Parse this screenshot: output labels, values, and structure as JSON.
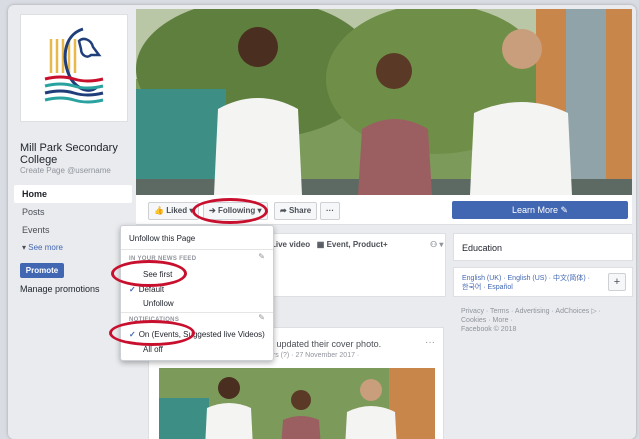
{
  "page": {
    "name": "Mill Park Secondary College",
    "handle": "Create Page @username"
  },
  "nav": {
    "items": [
      "Home",
      "Posts",
      "Events"
    ],
    "see_more": "See more",
    "promote": "Promote",
    "manage": "Manage promotions"
  },
  "actions": {
    "liked": "Liked",
    "following": "Following",
    "share": "Share",
    "more": "···",
    "learn_more": "Learn More"
  },
  "menu": {
    "unfollow_page": "Unfollow this Page",
    "news_feed_head": "IN YOUR NEWS FEED",
    "see_first": "See first",
    "default": "Default",
    "unfollow": "Unfollow",
    "notifications_head": "NOTIFICATIONS",
    "on_events": "On (Events, Suggested live Videos)",
    "all_off": "All off"
  },
  "composer": {
    "tab_live": "Live video",
    "tab_event": "Event, Product+"
  },
  "post": {
    "headline": "e updated their cover photo.",
    "meta": "ers (?) · 27 November 2017 ·",
    "menu": "···"
  },
  "sidebar": {
    "education": "Education",
    "languages_line1": "English (UK) · English (US) · 中文(简体) ·",
    "languages_line2": "한국어 · Español",
    "add_lang": "+",
    "legal_line1": "Privacy · Terms · Advertising · AdChoices ▷ ·",
    "legal_line2": "Cookies · More ·",
    "legal_line3": "Facebook © 2018"
  },
  "colors": {
    "facebook_blue": "#4267b2",
    "highlight_red": "#c8102e",
    "page_bg": "#e9ebee"
  }
}
